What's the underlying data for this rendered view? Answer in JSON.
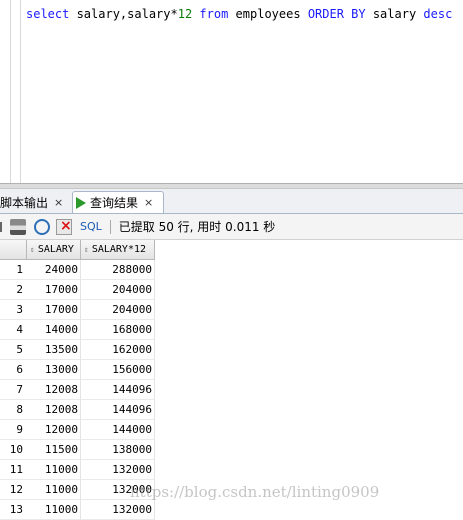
{
  "editor": {
    "sql_tokens": [
      {
        "text": "select",
        "kind": "kw"
      },
      {
        "text": " salary,salary*",
        "kind": "plain"
      },
      {
        "text": "12",
        "kind": "num"
      },
      {
        "text": " ",
        "kind": "plain"
      },
      {
        "text": "from",
        "kind": "kw"
      },
      {
        "text": " employees ",
        "kind": "plain"
      },
      {
        "text": "ORDER BY",
        "kind": "kw"
      },
      {
        "text": " salary ",
        "kind": "plain"
      },
      {
        "text": "desc",
        "kind": "kw"
      }
    ]
  },
  "tabs": {
    "script_output": "脚本输出",
    "query_result": "查询结果",
    "close": "×"
  },
  "toolbar": {
    "sql_label": "SQL",
    "status": "已提取 50 行, 用时 0.011 秒"
  },
  "grid": {
    "columns": [
      "SALARY",
      "SALARY*12"
    ],
    "rows": [
      {
        "n": "1",
        "salary": "24000",
        "annual": "288000"
      },
      {
        "n": "2",
        "salary": "17000",
        "annual": "204000"
      },
      {
        "n": "3",
        "salary": "17000",
        "annual": "204000"
      },
      {
        "n": "4",
        "salary": "14000",
        "annual": "168000"
      },
      {
        "n": "5",
        "salary": "13500",
        "annual": "162000"
      },
      {
        "n": "6",
        "salary": "13000",
        "annual": "156000"
      },
      {
        "n": "7",
        "salary": "12008",
        "annual": "144096"
      },
      {
        "n": "8",
        "salary": "12008",
        "annual": "144096"
      },
      {
        "n": "9",
        "salary": "12000",
        "annual": "144000"
      },
      {
        "n": "10",
        "salary": "11500",
        "annual": "138000"
      },
      {
        "n": "11",
        "salary": "11000",
        "annual": "132000"
      },
      {
        "n": "12",
        "salary": "11000",
        "annual": "132000"
      },
      {
        "n": "13",
        "salary": "11000",
        "annual": "132000"
      }
    ]
  },
  "watermark": "https://blog.csdn.net/linting0909",
  "icons": [
    "pin-icon",
    "print-icon",
    "refresh-icon",
    "cancel-icon",
    "play-icon",
    "sort-icon"
  ]
}
